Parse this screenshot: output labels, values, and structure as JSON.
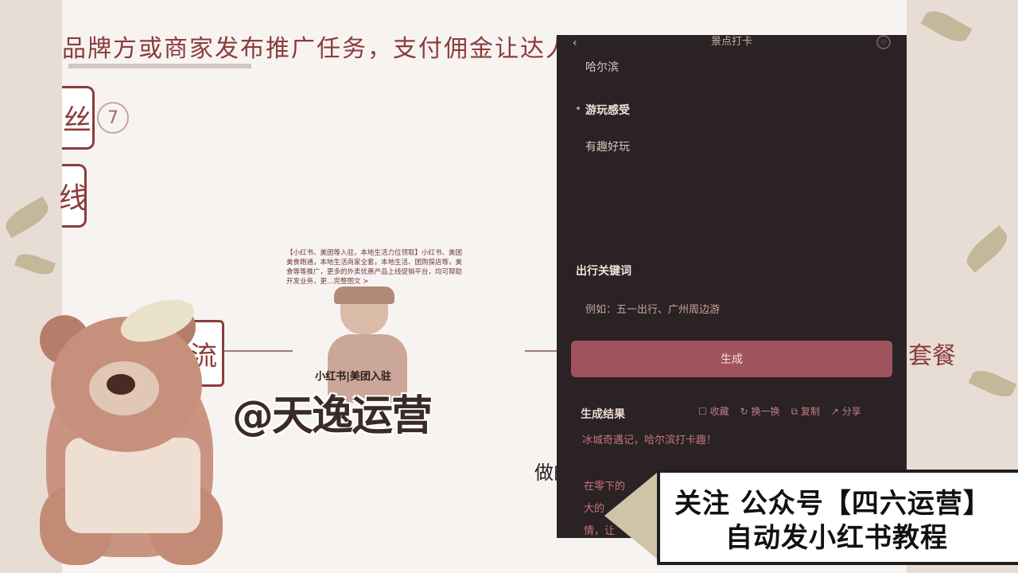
{
  "slide": {
    "top_text": "品牌方或商家发布推广任务，支付佣金让达人",
    "box1": "丝",
    "circle_number": "7",
    "box2": "线",
    "flow_box": "流",
    "right_label": "套餐",
    "tiny_text": "【小红书、美团等入驻，本地生活力位领取】小红书、美团美食跑通，本地生活商家全套，本地生活、团购探店等，美食等等推广，更多的外卖优惠产品上线促销平台，均可帮助开发业务，更…完整图文 >",
    "cartoon_sign": "小红书|美团入驻",
    "watermark": "@天逸运营",
    "annotation": "做的"
  },
  "phone": {
    "title": "景点打卡",
    "back_icon": "‹",
    "menu_icon": "◎",
    "city": "哈尔滨",
    "feeling_label": "游玩感受",
    "feeling_value": "有趣好玩",
    "keyword_label": "出行关键词",
    "keyword_placeholder": "例如：五一出行、广州周边游",
    "generate_button": "生成",
    "result_label": "生成结果",
    "actions": {
      "save": "收藏",
      "swap": "换一换",
      "copy": "复制",
      "share": "分享"
    },
    "result_title": "冰城奇遇记，哈尔滨打卡趣！",
    "result_line1": "在零下的",
    "result_line2": "大的",
    "result_line3": "情，让"
  },
  "banner": {
    "line1": "关注 公众号【四六运营】",
    "line2": "自动发小红书教程"
  },
  "colors": {
    "accent": "#8a3c3c",
    "phone_bg": "#2a2224",
    "button": "#a0525d"
  }
}
